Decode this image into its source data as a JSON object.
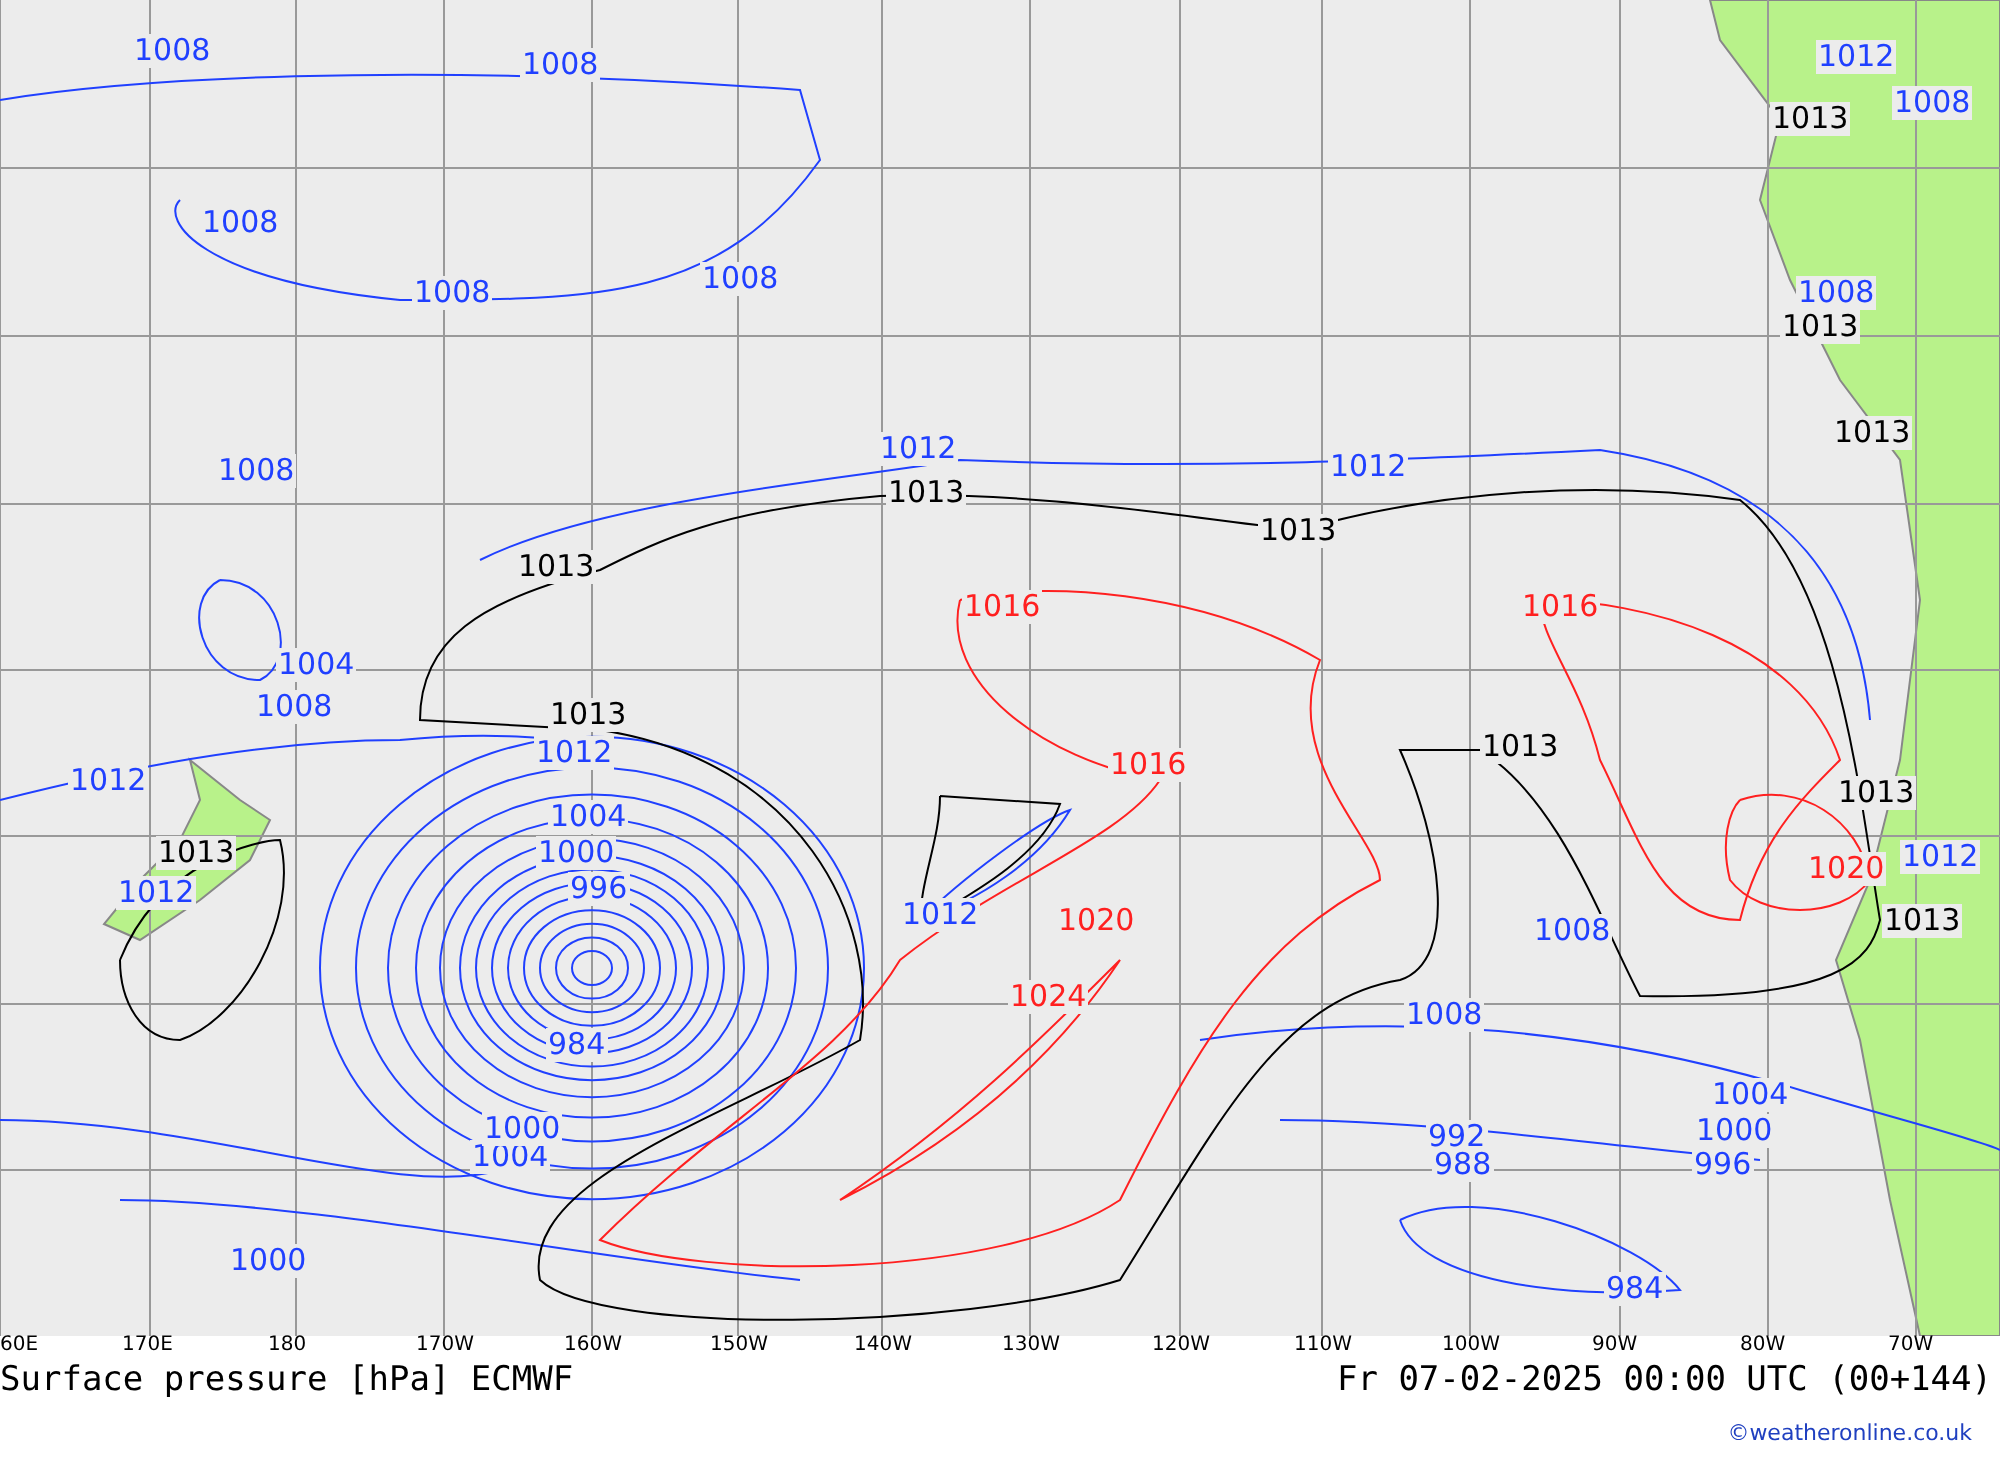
{
  "map": {
    "isobar_labels": [
      {
        "text": "1008",
        "kind": "low"
      },
      {
        "text": "1008",
        "kind": "low"
      },
      {
        "text": "1008",
        "kind": "low"
      },
      {
        "text": "1008",
        "kind": "low"
      },
      {
        "text": "1008",
        "kind": "low"
      },
      {
        "text": "1008",
        "kind": "low"
      },
      {
        "text": "1012",
        "kind": "low"
      },
      {
        "text": "1012",
        "kind": "low"
      },
      {
        "text": "1004",
        "kind": "low"
      },
      {
        "text": "1008",
        "kind": "low"
      },
      {
        "text": "1012",
        "kind": "low"
      },
      {
        "text": "1012",
        "kind": "low"
      },
      {
        "text": "1012",
        "kind": "low"
      },
      {
        "text": "1004",
        "kind": "low"
      },
      {
        "text": "1000",
        "kind": "low"
      },
      {
        "text": "996",
        "kind": "low"
      },
      {
        "text": "984",
        "kind": "low"
      },
      {
        "text": "1012",
        "kind": "low"
      },
      {
        "text": "1008",
        "kind": "low"
      },
      {
        "text": "1008",
        "kind": "low"
      },
      {
        "text": "1004",
        "kind": "low"
      },
      {
        "text": "1000",
        "kind": "low"
      },
      {
        "text": "996",
        "kind": "low"
      },
      {
        "text": "992",
        "kind": "low"
      },
      {
        "text": "988",
        "kind": "low"
      },
      {
        "text": "984",
        "kind": "low"
      },
      {
        "text": "1004",
        "kind": "low"
      },
      {
        "text": "1000",
        "kind": "low"
      },
      {
        "text": "1000",
        "kind": "low"
      },
      {
        "text": "1012",
        "kind": "low"
      },
      {
        "text": "1008",
        "kind": "low"
      },
      {
        "text": "1008",
        "kind": "low"
      },
      {
        "text": "1012",
        "kind": "low"
      },
      {
        "text": "1013",
        "kind": "mid"
      },
      {
        "text": "1013",
        "kind": "mid"
      },
      {
        "text": "1013",
        "kind": "mid"
      },
      {
        "text": "1013",
        "kind": "mid"
      },
      {
        "text": "1013",
        "kind": "mid"
      },
      {
        "text": "1013",
        "kind": "mid"
      },
      {
        "text": "1013",
        "kind": "mid"
      },
      {
        "text": "1013",
        "kind": "mid"
      },
      {
        "text": "1013",
        "kind": "mid"
      },
      {
        "text": "1013",
        "kind": "mid"
      },
      {
        "text": "1013",
        "kind": "mid"
      },
      {
        "text": "1016",
        "kind": "high"
      },
      {
        "text": "1016",
        "kind": "high"
      },
      {
        "text": "1016",
        "kind": "high"
      },
      {
        "text": "1020",
        "kind": "high"
      },
      {
        "text": "1024",
        "kind": "high"
      },
      {
        "text": "1020",
        "kind": "high"
      }
    ],
    "longitude_labels": [
      "60E",
      "170E",
      "180",
      "170W",
      "160W",
      "150W",
      "140W",
      "130W",
      "120W",
      "110W",
      "100W",
      "90W",
      "80W",
      "70W"
    ]
  },
  "title": "Surface pressure [hPa] ECMWF",
  "valid_time": "Fr 07-02-2025 00:00 UTC (00+144)",
  "credit": "©weatheronline.co.uk"
}
